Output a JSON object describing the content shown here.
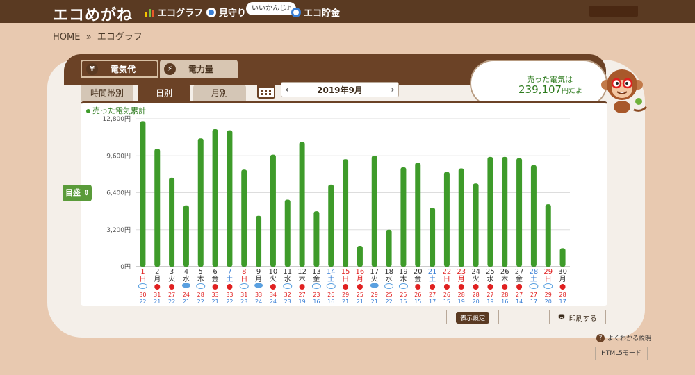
{
  "header": {
    "logo": "エコめがね",
    "nav": [
      {
        "label": "エコグラフ",
        "icon": "bar-chart-icon"
      },
      {
        "label": "見守り",
        "icon": "monitor-icon"
      },
      {
        "label": "エコ貯金",
        "icon": "coin-icon"
      }
    ],
    "mimamori_tag": "いいかんじ♪"
  },
  "breadcrumb": {
    "home": "HOME",
    "separator": "»",
    "current": "エコグラフ"
  },
  "main_tabs": [
    {
      "label": "電気代",
      "icon": "yen-icon",
      "active": true
    },
    {
      "label": "電力量",
      "icon": "bolt-icon",
      "active": false
    }
  ],
  "sub_tabs": [
    {
      "label": "時間帯別",
      "active": false
    },
    {
      "label": "日別",
      "active": true
    },
    {
      "label": "月別",
      "active": false
    }
  ],
  "month_nav": {
    "prev": "‹",
    "label": "2019年9月",
    "next": "›"
  },
  "scale_button": "目盛",
  "speech": {
    "line1": "売った電気は",
    "amount": "239,107",
    "suffix": "円だよ"
  },
  "toolbar": {
    "display_settings": "表示設定",
    "print": "印刷する"
  },
  "help": {
    "label": "よくわかる説明",
    "html5": "HTML5モード"
  },
  "colors": {
    "bar": "#3e9b2a",
    "sat": "#3a7fd5",
    "sun": "#e02020",
    "weekday": "#333333",
    "header": "#5a3a22"
  },
  "chart_data": {
    "type": "bar",
    "legend": "売った電気累計",
    "y_ticks": [
      "0円",
      "3,200円",
      "6,400円",
      "9,600円",
      "12,800円"
    ],
    "ylim": [
      0,
      12800
    ],
    "days": [
      "1",
      "2",
      "3",
      "4",
      "5",
      "6",
      "7",
      "8",
      "9",
      "10",
      "11",
      "12",
      "13",
      "14",
      "15",
      "16",
      "17",
      "18",
      "19",
      "20",
      "21",
      "22",
      "23",
      "24",
      "25",
      "26",
      "27",
      "28",
      "29",
      "30"
    ],
    "weekdays": [
      "日",
      "月",
      "火",
      "水",
      "木",
      "金",
      "土",
      "日",
      "月",
      "火",
      "水",
      "木",
      "金",
      "土",
      "日",
      "月",
      "火",
      "水",
      "木",
      "金",
      "土",
      "日",
      "月",
      "火",
      "水",
      "木",
      "金",
      "土",
      "日",
      "月"
    ],
    "day_types": [
      "sun",
      "wk",
      "wk",
      "wk",
      "wk",
      "wk",
      "sat",
      "sun",
      "wk",
      "wk",
      "wk",
      "wk",
      "wk",
      "sat",
      "sun",
      "sun",
      "wk",
      "wk",
      "wk",
      "wk",
      "sat",
      "sun",
      "sun",
      "wk",
      "wk",
      "wk",
      "wk",
      "sat",
      "sun",
      "wk"
    ],
    "values": [
      12600,
      10200,
      7700,
      5300,
      11100,
      11900,
      11800,
      8400,
      4400,
      9700,
      5800,
      10800,
      4800,
      7100,
      9300,
      1800,
      9600,
      3200,
      8600,
      9000,
      5100,
      8200,
      8500,
      7200,
      9500,
      9500,
      9400,
      8800,
      5400,
      1600
    ],
    "weather": [
      "cloud",
      "sun",
      "sun",
      "rain",
      "cloud",
      "sun",
      "sun",
      "cloud",
      "rain",
      "sun",
      "cloud",
      "sun",
      "cloud",
      "cloud",
      "sun",
      "sun",
      "rain",
      "cloud",
      "cloud",
      "sun",
      "sun",
      "sun",
      "sun",
      "sun",
      "sun",
      "sun",
      "sun",
      "cloud",
      "cloud",
      "sun"
    ],
    "temp_high": [
      "30",
      "31",
      "27",
      "24",
      "28",
      "33",
      "33",
      "31",
      "33",
      "34",
      "32",
      "27",
      "23",
      "26",
      "29",
      "25",
      "29",
      "25",
      "25",
      "26",
      "27",
      "26",
      "28",
      "28",
      "27",
      "28",
      "27",
      "27",
      "29",
      "28"
    ],
    "temp_low": [
      "22",
      "21",
      "22",
      "21",
      "22",
      "21",
      "22",
      "23",
      "24",
      "24",
      "23",
      "19",
      "16",
      "16",
      "21",
      "21",
      "21",
      "22",
      "15",
      "15",
      "17",
      "15",
      "19",
      "20",
      "19",
      "16",
      "14",
      "17",
      "20",
      "17"
    ]
  }
}
